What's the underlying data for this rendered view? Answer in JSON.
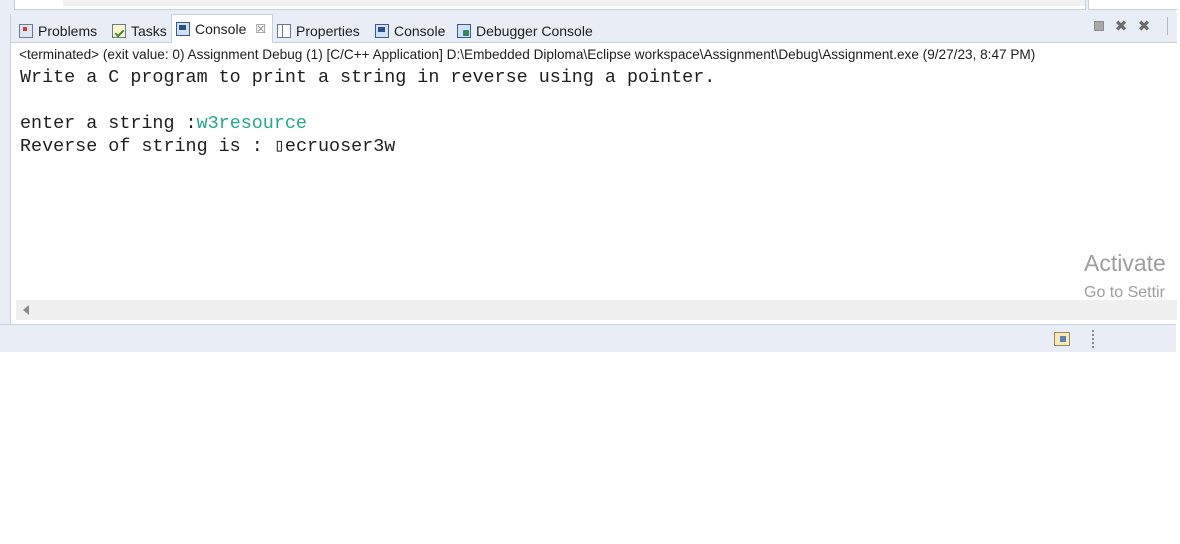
{
  "tabs": [
    {
      "label": "Problems",
      "icon": "problems-icon"
    },
    {
      "label": "Tasks",
      "icon": "tasks-icon"
    },
    {
      "label": "Console",
      "icon": "console-icon",
      "active": true,
      "close": "☒"
    },
    {
      "label": "Properties",
      "icon": "properties-icon"
    },
    {
      "label": "Console",
      "icon": "console-icon"
    },
    {
      "label": "Debugger Console",
      "icon": "debugger-console-icon"
    }
  ],
  "toolbar": {
    "terminate_icon": "stop-icon",
    "remove_icon": "remove-launch-icon",
    "remove_all_icon": "remove-all-icon",
    "remove_label": "✖",
    "remove_all_label": "✖"
  },
  "console": {
    "status": "<terminated> (exit value: 0) Assignment Debug (1) [C/C++ Application] D:\\Embedded Diploma\\Eclipse workspace\\Assignment\\Debug\\Assignment.exe (9/27/23, 8:47 PM)",
    "line1": "Write a C program to print a string in reverse using a pointer.",
    "prompt": "enter a string :",
    "user_input": "w3resource",
    "result": "Reverse of string is : ▯ecruoser3w"
  },
  "watermark": {
    "activate": "Activate",
    "goto": "Go to Settir"
  },
  "colors": {
    "chrome": "#e9eef6",
    "border": "#c8d0dc",
    "input_text": "#22a88f"
  }
}
